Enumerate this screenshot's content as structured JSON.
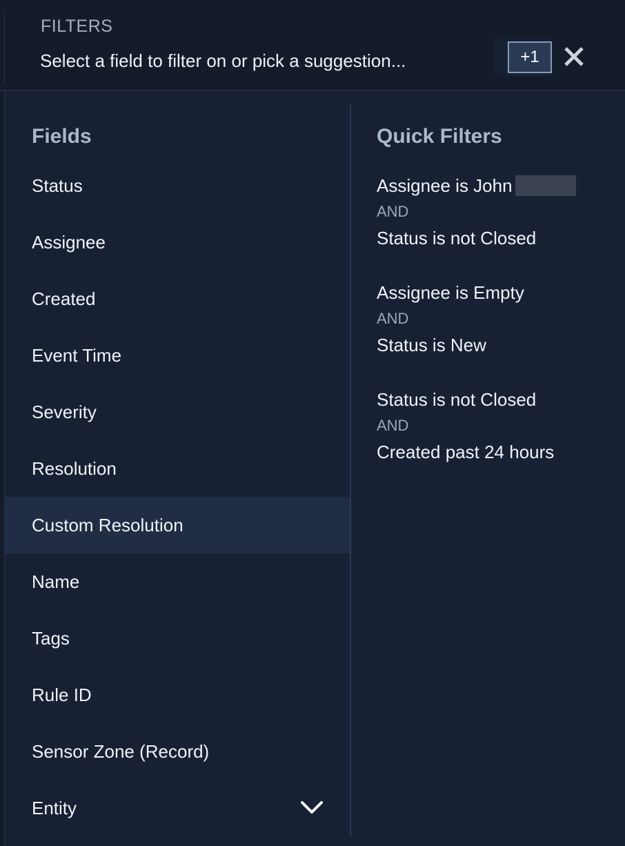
{
  "header": {
    "label": "FILTERS",
    "input_placeholder": "Select a field to filter on or pick a suggestion...",
    "count_badge": "+1",
    "close_icon": "close-x-icon"
  },
  "fields": {
    "title": "Fields",
    "items": [
      {
        "label": "Status"
      },
      {
        "label": "Assignee"
      },
      {
        "label": "Created"
      },
      {
        "label": "Event Time"
      },
      {
        "label": "Severity"
      },
      {
        "label": "Resolution"
      },
      {
        "label": "Custom Resolution",
        "highlighted": true
      },
      {
        "label": "Name"
      },
      {
        "label": "Tags"
      },
      {
        "label": "Rule ID"
      },
      {
        "label": "Sensor Zone (Record)"
      },
      {
        "label": "Entity"
      }
    ],
    "expand_icon": "chevron-down-icon"
  },
  "quick_filters": {
    "title": "Quick Filters",
    "items": [
      {
        "first": "Assignee is John",
        "joiner": "AND",
        "second": "Status is not Closed",
        "redacted": true
      },
      {
        "first": "Assignee is Empty",
        "joiner": "AND",
        "second": "Status is New"
      },
      {
        "first": "Status is not Closed",
        "joiner": "AND",
        "second": "Created past 24 hours"
      }
    ]
  },
  "colors": {
    "background": "#141b2b",
    "panel": "#182034",
    "highlight_row": "#212c45",
    "muted_text": "#aab8cc"
  }
}
